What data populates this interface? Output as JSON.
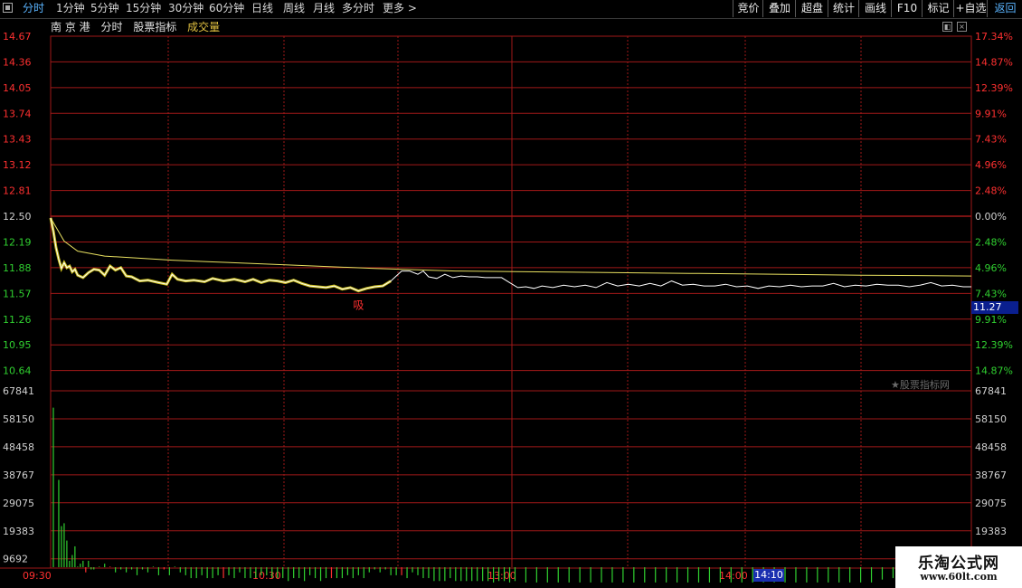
{
  "toolbar": {
    "left_items": [
      {
        "label": "分时",
        "active": true
      },
      {
        "label": "1分钟"
      },
      {
        "label": "5分钟"
      },
      {
        "label": "15分钟"
      },
      {
        "label": "30分钟"
      },
      {
        "label": "60分钟"
      },
      {
        "label": "日线"
      },
      {
        "label": "周线"
      },
      {
        "label": "月线"
      },
      {
        "label": "多分时"
      },
      {
        "label": "更多 >"
      }
    ],
    "right_items": [
      "竞价",
      "叠加",
      "超盘",
      "统计",
      "画线",
      "F10",
      "标记",
      "+自选",
      "返回"
    ]
  },
  "infobar": {
    "stock_name": "南 京 港",
    "tab_fenshi": "分时",
    "tab_indicator": "股票指标",
    "tab_volume": "成交量"
  },
  "price_axis": {
    "left_labels": [
      "14.67",
      "14.36",
      "14.05",
      "13.74",
      "13.43",
      "13.12",
      "12.81",
      "12.50",
      "12.19",
      "11.88",
      "11.57",
      "11.26",
      "10.95",
      "10.64"
    ],
    "right_labels": [
      "17.34%",
      "14.87%",
      "12.39%",
      "9.91%",
      "7.43%",
      "4.96%",
      "2.48%",
      "0.00%",
      "2.48%",
      "4.96%",
      "7.43%",
      "9.91%",
      "12.39%",
      "14.87%"
    ]
  },
  "volume_axis": {
    "labels": [
      "67841",
      "58150",
      "48458",
      "38767",
      "29075",
      "19383",
      "9692"
    ]
  },
  "time_axis": {
    "labels": [
      "09:30",
      "10:30",
      "13:00",
      "14:00"
    ]
  },
  "current_price_tag": "11.27",
  "current_time_tag": "14:10",
  "signal_label": "吸",
  "watermark": "★股票指标网",
  "brand": {
    "title": "乐淘公式网",
    "url": "www.60lt.com"
  },
  "colors": {
    "up": "#ff3030",
    "down": "#30d030",
    "price_line": "#ffffff",
    "avg_line": "#e8e060",
    "grid": "#a01818",
    "accent_blue": "#5ab4ff"
  },
  "chart_data": {
    "type": "line",
    "title": "",
    "prev_close": 12.5,
    "price_range": [
      10.64,
      14.67
    ],
    "volume_range": [
      0,
      67841
    ],
    "time_labels": [
      "09:30",
      "10:30",
      "13:00",
      "14:00"
    ],
    "price_series": [
      {
        "t": 0,
        "v": 12.48
      },
      {
        "t": 1,
        "v": 12.32
      },
      {
        "t": 2,
        "v": 12.12
      },
      {
        "t": 3,
        "v": 11.98
      },
      {
        "t": 4,
        "v": 11.87
      },
      {
        "t": 5,
        "v": 11.94
      },
      {
        "t": 6,
        "v": 11.88
      },
      {
        "t": 7,
        "v": 11.9
      },
      {
        "t": 8,
        "v": 11.83
      },
      {
        "t": 9,
        "v": 11.86
      },
      {
        "t": 10,
        "v": 11.79
      },
      {
        "t": 12,
        "v": 11.76
      },
      {
        "t": 14,
        "v": 11.82
      },
      {
        "t": 16,
        "v": 11.86
      },
      {
        "t": 18,
        "v": 11.85
      },
      {
        "t": 20,
        "v": 11.79
      },
      {
        "t": 22,
        "v": 11.9
      },
      {
        "t": 24,
        "v": 11.85
      },
      {
        "t": 26,
        "v": 11.88
      },
      {
        "t": 28,
        "v": 11.78
      },
      {
        "t": 30,
        "v": 11.77
      },
      {
        "t": 33,
        "v": 11.72
      },
      {
        "t": 36,
        "v": 11.73
      },
      {
        "t": 40,
        "v": 11.7
      },
      {
        "t": 43,
        "v": 11.68
      },
      {
        "t": 45,
        "v": 11.8
      },
      {
        "t": 47,
        "v": 11.74
      },
      {
        "t": 50,
        "v": 11.72
      },
      {
        "t": 53,
        "v": 11.73
      },
      {
        "t": 57,
        "v": 11.71
      },
      {
        "t": 60,
        "v": 11.75
      },
      {
        "t": 64,
        "v": 11.72
      },
      {
        "t": 68,
        "v": 11.74
      },
      {
        "t": 72,
        "v": 11.71
      },
      {
        "t": 75,
        "v": 11.74
      },
      {
        "t": 78,
        "v": 11.7
      },
      {
        "t": 81,
        "v": 11.73
      },
      {
        "t": 84,
        "v": 11.72
      },
      {
        "t": 87,
        "v": 11.7
      },
      {
        "t": 90,
        "v": 11.73
      },
      {
        "t": 93,
        "v": 11.69
      },
      {
        "t": 96,
        "v": 11.66
      },
      {
        "t": 99,
        "v": 11.65
      },
      {
        "t": 102,
        "v": 11.64
      },
      {
        "t": 105,
        "v": 11.66
      },
      {
        "t": 108,
        "v": 11.62
      },
      {
        "t": 111,
        "v": 11.64
      },
      {
        "t": 114,
        "v": 11.6
      },
      {
        "t": 117,
        "v": 11.63
      },
      {
        "t": 120,
        "v": 11.65
      },
      {
        "t": 123,
        "v": 11.66
      },
      {
        "t": 126,
        "v": 11.72
      },
      {
        "t": 128,
        "v": 11.78
      },
      {
        "t": 130,
        "v": 11.84
      },
      {
        "t": 133,
        "v": 11.84
      },
      {
        "t": 136,
        "v": 11.8
      },
      {
        "t": 138,
        "v": 11.84
      },
      {
        "t": 140,
        "v": 11.77
      },
      {
        "t": 143,
        "v": 11.75
      },
      {
        "t": 146,
        "v": 11.8
      },
      {
        "t": 149,
        "v": 11.76
      },
      {
        "t": 152,
        "v": 11.78
      },
      {
        "t": 155,
        "v": 11.77
      },
      {
        "t": 158,
        "v": 11.77
      },
      {
        "t": 161,
        "v": 11.76
      },
      {
        "t": 164,
        "v": 11.76
      },
      {
        "t": 167,
        "v": 11.76
      },
      {
        "t": 170,
        "v": 11.7
      },
      {
        "t": 173,
        "v": 11.64
      },
      {
        "t": 176,
        "v": 11.65
      },
      {
        "t": 179,
        "v": 11.63
      },
      {
        "t": 182,
        "v": 11.66
      },
      {
        "t": 186,
        "v": 11.64
      },
      {
        "t": 190,
        "v": 11.67
      },
      {
        "t": 194,
        "v": 11.65
      },
      {
        "t": 198,
        "v": 11.67
      },
      {
        "t": 202,
        "v": 11.64
      },
      {
        "t": 206,
        "v": 11.7
      },
      {
        "t": 210,
        "v": 11.66
      },
      {
        "t": 214,
        "v": 11.68
      },
      {
        "t": 218,
        "v": 11.66
      },
      {
        "t": 222,
        "v": 11.69
      },
      {
        "t": 226,
        "v": 11.66
      },
      {
        "t": 230,
        "v": 11.72
      },
      {
        "t": 234,
        "v": 11.67
      },
      {
        "t": 238,
        "v": 11.68
      },
      {
        "t": 242,
        "v": 11.66
      },
      {
        "t": 246,
        "v": 11.66
      },
      {
        "t": 250,
        "v": 11.68
      },
      {
        "t": 254,
        "v": 11.65
      },
      {
        "t": 258,
        "v": 11.66
      },
      {
        "t": 262,
        "v": 11.63
      },
      {
        "t": 266,
        "v": 11.66
      },
      {
        "t": 270,
        "v": 11.65
      },
      {
        "t": 274,
        "v": 11.67
      },
      {
        "t": 278,
        "v": 11.65
      },
      {
        "t": 282,
        "v": 11.66
      },
      {
        "t": 286,
        "v": 11.66
      },
      {
        "t": 290,
        "v": 11.69
      },
      {
        "t": 294,
        "v": 11.65
      },
      {
        "t": 298,
        "v": 11.67
      },
      {
        "t": 302,
        "v": 11.66
      },
      {
        "t": 306,
        "v": 11.68
      },
      {
        "t": 310,
        "v": 11.67
      },
      {
        "t": 314,
        "v": 11.67
      },
      {
        "t": 318,
        "v": 11.65
      },
      {
        "t": 322,
        "v": 11.67
      },
      {
        "t": 326,
        "v": 11.7
      },
      {
        "t": 330,
        "v": 11.66
      },
      {
        "t": 334,
        "v": 11.67
      },
      {
        "t": 338,
        "v": 11.65
      },
      {
        "t": 341,
        "v": 11.65
      }
    ],
    "avg_series": [
      {
        "t": 0,
        "v": 12.48
      },
      {
        "t": 5,
        "v": 12.2
      },
      {
        "t": 10,
        "v": 12.08
      },
      {
        "t": 20,
        "v": 12.02
      },
      {
        "t": 30,
        "v": 12.0
      },
      {
        "t": 45,
        "v": 11.97
      },
      {
        "t": 60,
        "v": 11.95
      },
      {
        "t": 90,
        "v": 11.91
      },
      {
        "t": 120,
        "v": 11.87
      },
      {
        "t": 150,
        "v": 11.84
      },
      {
        "t": 180,
        "v": 11.83
      },
      {
        "t": 240,
        "v": 11.81
      },
      {
        "t": 300,
        "v": 11.79
      },
      {
        "t": 341,
        "v": 11.78
      }
    ],
    "volume_series": [
      {
        "t": 1,
        "v": 62000,
        "up": false
      },
      {
        "t": 3,
        "v": 37000,
        "up": false
      },
      {
        "t": 4,
        "v": 21000,
        "up": false
      },
      {
        "t": 5,
        "v": 22000,
        "up": false
      },
      {
        "t": 6,
        "v": 16000,
        "up": false
      },
      {
        "t": 7,
        "v": 9000,
        "up": false
      },
      {
        "t": 8,
        "v": 11000,
        "up": false
      },
      {
        "t": 9,
        "v": 14000,
        "up": false
      },
      {
        "t": 10,
        "v": 7000,
        "up": false
      },
      {
        "t": 11,
        "v": 8000,
        "up": false
      },
      {
        "t": 12,
        "v": 9000,
        "up": false
      },
      {
        "t": 13,
        "v": 5000,
        "up": true
      },
      {
        "t": 14,
        "v": 9000,
        "up": false
      },
      {
        "t": 15,
        "v": 6000,
        "up": false
      },
      {
        "t": 16,
        "v": 6000,
        "up": false
      },
      {
        "t": 18,
        "v": 7000,
        "up": false
      },
      {
        "t": 20,
        "v": 8000,
        "up": false
      },
      {
        "t": 22,
        "v": 7000,
        "up": true
      },
      {
        "t": 24,
        "v": 5000,
        "up": false
      },
      {
        "t": 26,
        "v": 6000,
        "up": false
      },
      {
        "t": 28,
        "v": 5000,
        "up": false
      },
      {
        "t": 30,
        "v": 6000,
        "up": false
      },
      {
        "t": 32,
        "v": 4000,
        "up": false
      },
      {
        "t": 34,
        "v": 6000,
        "up": false
      },
      {
        "t": 36,
        "v": 5000,
        "up": false
      },
      {
        "t": 38,
        "v": 7000,
        "up": false
      },
      {
        "t": 40,
        "v": 4000,
        "up": false
      },
      {
        "t": 42,
        "v": 6000,
        "up": true
      },
      {
        "t": 44,
        "v": 4000,
        "up": false
      },
      {
        "t": 46,
        "v": 7000,
        "up": false
      },
      {
        "t": 48,
        "v": 5000,
        "up": false
      },
      {
        "t": 50,
        "v": 4000,
        "up": false
      },
      {
        "t": 52,
        "v": 3000,
        "up": false
      },
      {
        "t": 54,
        "v": 3000,
        "up": false
      },
      {
        "t": 56,
        "v": 4000,
        "up": false
      },
      {
        "t": 58,
        "v": 3000,
        "up": false
      },
      {
        "t": 60,
        "v": 3000,
        "up": false
      },
      {
        "t": 62,
        "v": 4000,
        "up": false
      },
      {
        "t": 64,
        "v": 3000,
        "up": true
      },
      {
        "t": 66,
        "v": 4000,
        "up": false
      },
      {
        "t": 68,
        "v": 3000,
        "up": false
      },
      {
        "t": 70,
        "v": 5000,
        "up": false
      },
      {
        "t": 72,
        "v": 3000,
        "up": false
      },
      {
        "t": 74,
        "v": 3000,
        "up": false
      },
      {
        "t": 76,
        "v": 3000,
        "up": false
      },
      {
        "t": 78,
        "v": 4000,
        "up": false
      },
      {
        "t": 80,
        "v": 4000,
        "up": false
      },
      {
        "t": 82,
        "v": 3000,
        "up": false
      },
      {
        "t": 84,
        "v": 3000,
        "up": false
      },
      {
        "t": 86,
        "v": 3000,
        "up": false
      },
      {
        "t": 88,
        "v": 2000,
        "up": false
      },
      {
        "t": 90,
        "v": 3000,
        "up": false
      },
      {
        "t": 92,
        "v": 3000,
        "up": false
      },
      {
        "t": 94,
        "v": 2000,
        "up": false
      },
      {
        "t": 96,
        "v": 4000,
        "up": false
      },
      {
        "t": 98,
        "v": 3000,
        "up": false
      },
      {
        "t": 100,
        "v": 2000,
        "up": false
      },
      {
        "t": 102,
        "v": 3000,
        "up": false
      },
      {
        "t": 104,
        "v": 3000,
        "up": true
      },
      {
        "t": 106,
        "v": 3000,
        "up": false
      },
      {
        "t": 108,
        "v": 3000,
        "up": false
      },
      {
        "t": 110,
        "v": 4000,
        "up": false
      },
      {
        "t": 112,
        "v": 3000,
        "up": false
      },
      {
        "t": 114,
        "v": 4000,
        "up": false
      },
      {
        "t": 116,
        "v": 3000,
        "up": false
      },
      {
        "t": 118,
        "v": 5000,
        "up": false
      },
      {
        "t": 120,
        "v": 6000,
        "up": false
      },
      {
        "t": 122,
        "v": 5000,
        "up": false
      },
      {
        "t": 124,
        "v": 6000,
        "up": false
      },
      {
        "t": 126,
        "v": 4000,
        "up": false
      },
      {
        "t": 128,
        "v": 4000,
        "up": false
      },
      {
        "t": 130,
        "v": 4000,
        "up": true
      },
      {
        "t": 132,
        "v": 3000,
        "up": false
      },
      {
        "t": 134,
        "v": 5000,
        "up": false
      },
      {
        "t": 136,
        "v": 4000,
        "up": false
      },
      {
        "t": 138,
        "v": 3000,
        "up": false
      },
      {
        "t": 140,
        "v": 3000,
        "up": false
      },
      {
        "t": 142,
        "v": 2000,
        "up": false
      },
      {
        "t": 144,
        "v": 2000,
        "up": false
      },
      {
        "t": 146,
        "v": 2000,
        "up": false
      },
      {
        "t": 148,
        "v": 3000,
        "up": false
      },
      {
        "t": 150,
        "v": 2000,
        "up": false
      },
      {
        "t": 152,
        "v": 2000,
        "up": false
      },
      {
        "t": 154,
        "v": 2000,
        "up": false
      },
      {
        "t": 156,
        "v": 2000,
        "up": false
      },
      {
        "t": 158,
        "v": 2000,
        "up": false
      },
      {
        "t": 160,
        "v": 2000,
        "up": false
      },
      {
        "t": 162,
        "v": 2000,
        "up": false
      },
      {
        "t": 164,
        "v": 1500,
        "up": false
      },
      {
        "t": 166,
        "v": 2000,
        "up": false
      },
      {
        "t": 168,
        "v": 2000,
        "up": false
      },
      {
        "t": 170,
        "v": 1500,
        "up": false
      },
      {
        "t": 172,
        "v": 2000,
        "up": false
      },
      {
        "t": 176,
        "v": 1500,
        "up": false
      },
      {
        "t": 180,
        "v": 1500,
        "up": false
      },
      {
        "t": 184,
        "v": 1500,
        "up": false
      },
      {
        "t": 188,
        "v": 1500,
        "up": false
      },
      {
        "t": 192,
        "v": 1500,
        "up": false
      },
      {
        "t": 196,
        "v": 1500,
        "up": false
      },
      {
        "t": 200,
        "v": 1500,
        "up": false
      },
      {
        "t": 204,
        "v": 1500,
        "up": false
      },
      {
        "t": 208,
        "v": 1500,
        "up": false
      },
      {
        "t": 212,
        "v": 1500,
        "up": false
      },
      {
        "t": 216,
        "v": 1500,
        "up": false
      },
      {
        "t": 220,
        "v": 1500,
        "up": false
      },
      {
        "t": 224,
        "v": 1500,
        "up": false
      },
      {
        "t": 228,
        "v": 1500,
        "up": false
      },
      {
        "t": 232,
        "v": 1500,
        "up": false
      },
      {
        "t": 236,
        "v": 1500,
        "up": false
      },
      {
        "t": 240,
        "v": 1500,
        "up": false
      },
      {
        "t": 244,
        "v": 1500,
        "up": false
      },
      {
        "t": 248,
        "v": 1500,
        "up": false
      },
      {
        "t": 252,
        "v": 1500,
        "up": false
      },
      {
        "t": 256,
        "v": 1500,
        "up": false
      },
      {
        "t": 260,
        "v": 1500,
        "up": false
      },
      {
        "t": 264,
        "v": 1500,
        "up": false
      },
      {
        "t": 268,
        "v": 1500,
        "up": false
      },
      {
        "t": 272,
        "v": 1500,
        "up": false
      },
      {
        "t": 276,
        "v": 1500,
        "up": false
      },
      {
        "t": 280,
        "v": 1500,
        "up": false
      },
      {
        "t": 284,
        "v": 1500,
        "up": false
      },
      {
        "t": 288,
        "v": 1500,
        "up": false
      },
      {
        "t": 292,
        "v": 1500,
        "up": false
      },
      {
        "t": 296,
        "v": 1500,
        "up": false
      },
      {
        "t": 300,
        "v": 1500,
        "up": false
      },
      {
        "t": 304,
        "v": 1500,
        "up": false
      },
      {
        "t": 308,
        "v": 2500,
        "up": false
      },
      {
        "t": 312,
        "v": 3000,
        "up": false
      },
      {
        "t": 316,
        "v": 5000,
        "up": false
      },
      {
        "t": 318,
        "v": 2000,
        "up": false
      },
      {
        "t": 322,
        "v": 2000,
        "up": false
      },
      {
        "t": 326,
        "v": 3000,
        "up": false
      },
      {
        "t": 330,
        "v": 2000,
        "up": false
      },
      {
        "t": 334,
        "v": 2000,
        "up": false
      },
      {
        "t": 336,
        "v": 1500,
        "up": false
      },
      {
        "t": 338,
        "v": 5000,
        "up": false
      },
      {
        "t": 341,
        "v": 10000,
        "up": false
      }
    ]
  }
}
